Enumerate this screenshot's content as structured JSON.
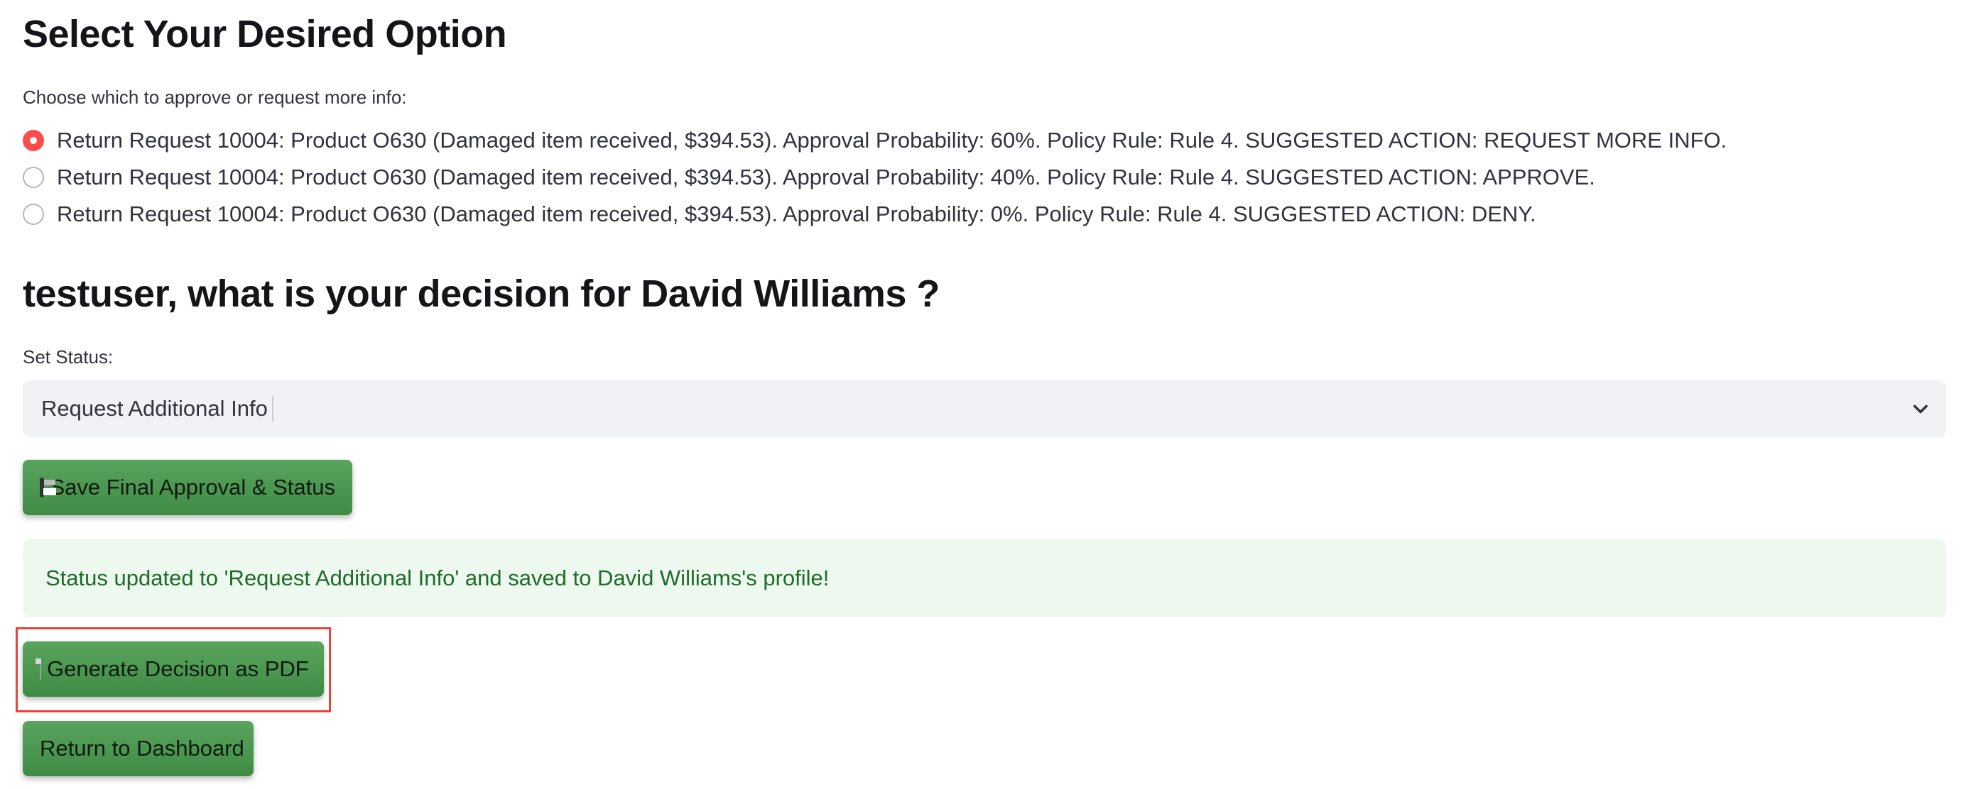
{
  "section1": {
    "title": "Select Your Desired Option",
    "radio_label": "Choose which to approve or request more info:",
    "options": [
      {
        "label": "Return Request 10004: Product O630 (Damaged item received, $394.53). Approval Probability: 60%. Policy Rule: Rule 4. SUGGESTED ACTION: REQUEST MORE INFO.",
        "selected": true
      },
      {
        "label": "Return Request 10004: Product O630 (Damaged item received, $394.53). Approval Probability: 40%. Policy Rule: Rule 4. SUGGESTED ACTION: APPROVE.",
        "selected": false
      },
      {
        "label": "Return Request 10004: Product O630 (Damaged item received, $394.53). Approval Probability: 0%. Policy Rule: Rule 4. SUGGESTED ACTION: DENY.",
        "selected": false
      }
    ]
  },
  "section2": {
    "title": "testuser, what is your decision for David Williams ?",
    "select_label": "Set Status:",
    "select_value": "Request Additional Info"
  },
  "buttons": {
    "save": "Save Final Approval & Status",
    "save_icon": "floppy-disk-icon",
    "pdf": "Generate Decision as PDF",
    "pdf_icon": "document-icon",
    "dashboard": "Return to Dashboard"
  },
  "alert": {
    "message": "Status updated to 'Request Additional Info' and saved to David Williams's profile!"
  },
  "colors": {
    "accent_radio": "#ff4b4b",
    "button_green": "#4a9a4f",
    "success_bg": "#edf8ef",
    "success_text": "#1f6b2a",
    "highlight_box": "#e8443a"
  }
}
